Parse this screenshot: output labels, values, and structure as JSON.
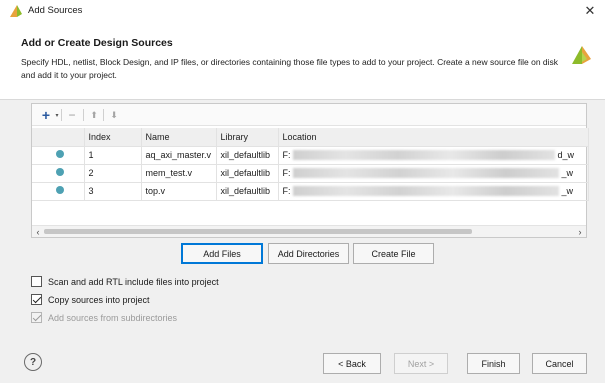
{
  "window": {
    "title": "Add Sources"
  },
  "header": {
    "title": "Add or Create Design Sources",
    "description": "Specify HDL, netlist, Block Design, and IP files, or directories containing those file types to add to your project. Create a new source file on disk and add it to your project."
  },
  "toolbar": {
    "add": "+",
    "remove": "−",
    "up": "⬆",
    "down": "⬇"
  },
  "table": {
    "columns": [
      "Index",
      "Name",
      "Library",
      "Location"
    ],
    "rows": [
      {
        "index": "1",
        "name": "aq_axi_master.v",
        "library": "xil_defaultlib",
        "location_start": "F:",
        "location_end": "d_w"
      },
      {
        "index": "2",
        "name": "mem_test.v",
        "library": "xil_defaultlib",
        "location_start": "F:",
        "location_end": "_w"
      },
      {
        "index": "3",
        "name": "top.v",
        "library": "xil_defaultlib",
        "location_start": "F:",
        "location_end": "_w"
      }
    ]
  },
  "actions": {
    "add_files": "Add Files",
    "add_directories": "Add Directories",
    "create_file": "Create File"
  },
  "options": {
    "scan_rtl": "Scan and add RTL include files into project",
    "copy_sources": "Copy sources into project",
    "add_subdirs": "Add sources from subdirectories"
  },
  "footer": {
    "help": "?",
    "back": "< Back",
    "next": "Next >",
    "finish": "Finish",
    "cancel": "Cancel"
  },
  "colors": {
    "status_dot": "#4ea1b3",
    "focus": "#0078d7",
    "logo_green": "#8dbb2a",
    "logo_orange": "#e8a33d"
  }
}
